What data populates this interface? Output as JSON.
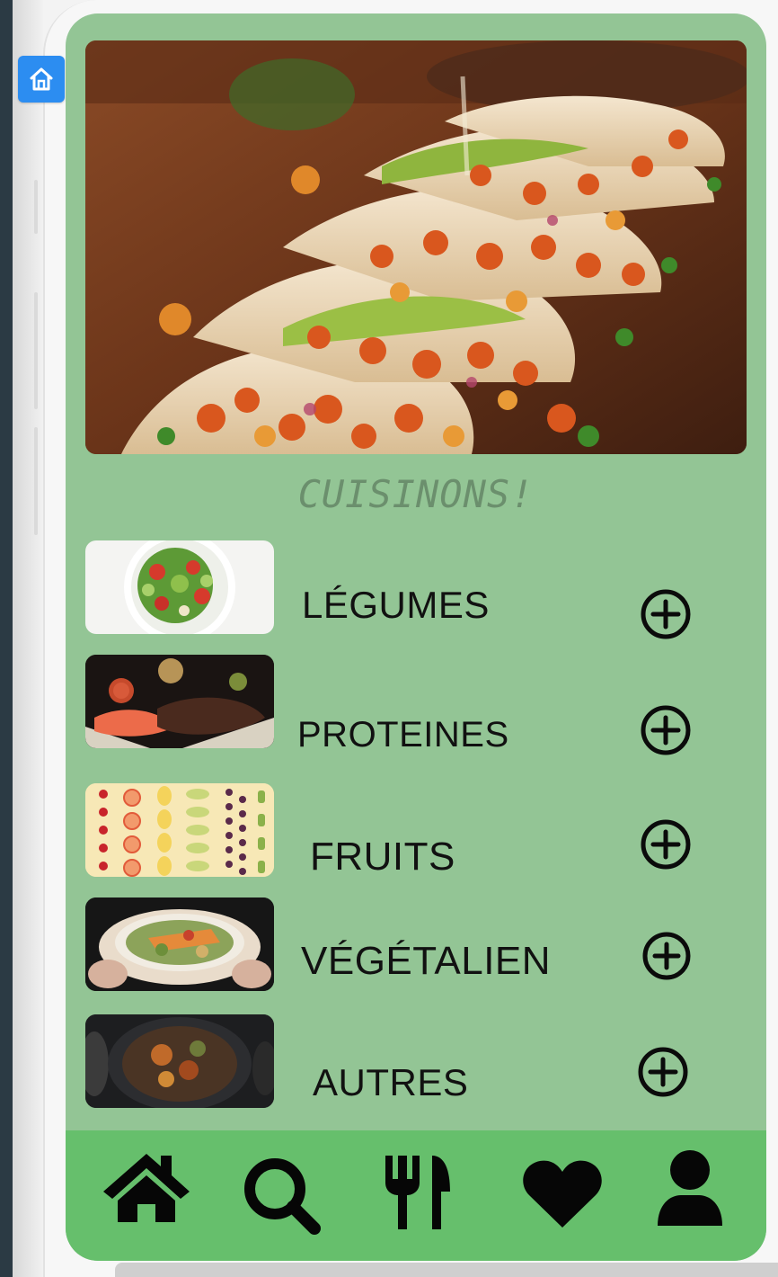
{
  "app": {
    "title": "CUISINONS!"
  },
  "colors": {
    "screen_background": "#93c595",
    "nav_background": "#66bf6c",
    "title_color": "#6b8f6d",
    "accent_blue": "#2c8df1"
  },
  "hero": {
    "image_subject": "tacos-image"
  },
  "categories": [
    {
      "label": "LÉGUMES",
      "thumb": "salad-thumbnail",
      "action_icon": "plus-circle-icon"
    },
    {
      "label": "PROTEINES",
      "thumb": "salmon-meat-thumbnail",
      "action_icon": "plus-circle-icon"
    },
    {
      "label": "FRUITS",
      "thumb": "fruit-slices-thumbnail",
      "action_icon": "plus-circle-icon"
    },
    {
      "label": "VÉGÉTALIEN",
      "thumb": "vegan-bowl-thumbnail",
      "action_icon": "plus-circle-icon"
    },
    {
      "label": "AUTRES",
      "thumb": "stew-thumbnail",
      "action_icon": "plus-circle-icon"
    }
  ],
  "bottom_nav": [
    {
      "icon": "home-icon"
    },
    {
      "icon": "search-icon"
    },
    {
      "icon": "utensils-icon"
    },
    {
      "icon": "heart-icon"
    },
    {
      "icon": "user-icon"
    }
  ]
}
